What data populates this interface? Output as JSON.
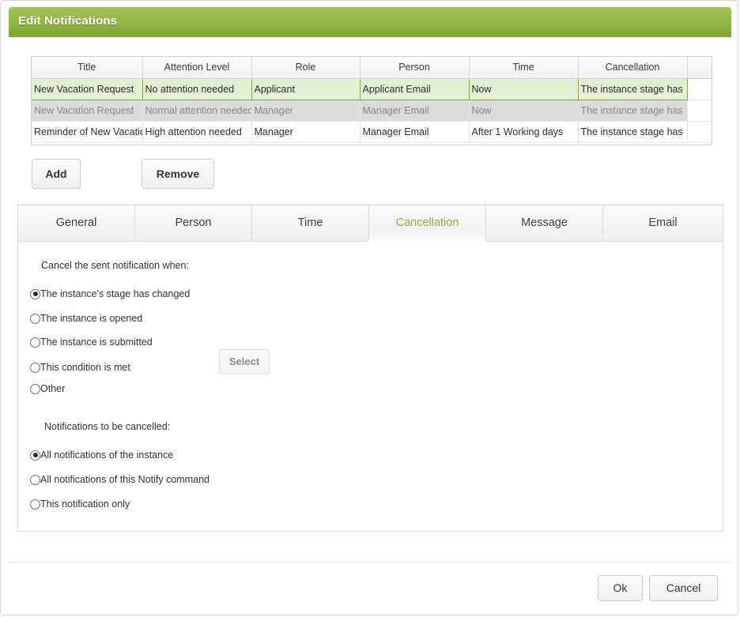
{
  "window": {
    "title": "Edit Notifications"
  },
  "grid": {
    "columns": [
      "Title",
      "Attention Level",
      "Role",
      "Person",
      "Time",
      "Cancellation",
      ""
    ],
    "rows": [
      {
        "state": "selected",
        "cells": [
          "New Vacation Request",
          "No attention needed",
          "Applicant",
          "Applicant Email",
          "Now",
          "The instance stage has",
          ""
        ]
      },
      {
        "state": "muted",
        "cells": [
          "New Vacation Request",
          "Normal attention needed",
          "Manager",
          "Manager Email",
          "Now",
          "The instance stage has",
          ""
        ]
      },
      {
        "state": "normal",
        "cells": [
          "Reminder of New Vacation",
          "High attention needed",
          "Manager",
          "Manager Email",
          "After 1 Working days",
          "The instance stage has",
          ""
        ]
      }
    ]
  },
  "toolbar": {
    "add_label": "Add",
    "remove_label": "Remove"
  },
  "tabs": [
    {
      "label": "General",
      "active": false
    },
    {
      "label": "Person",
      "active": false
    },
    {
      "label": "Time",
      "active": false
    },
    {
      "label": "Cancellation",
      "active": true
    },
    {
      "label": "Message",
      "active": false
    },
    {
      "label": "Email",
      "active": false
    }
  ],
  "panel": {
    "cancel_when_label": "Cancel the sent notification when:",
    "cancel_when_options": [
      {
        "label": "The instance's stage has changed",
        "checked": true
      },
      {
        "label": "The instance is opened",
        "checked": false
      },
      {
        "label": "The instance is submitted",
        "checked": false
      },
      {
        "label": "This condition is met",
        "checked": false
      },
      {
        "label": "Other",
        "checked": false
      }
    ],
    "select_button_label": "Select",
    "to_be_cancelled_label": "Notifications to be cancelled:",
    "to_be_cancelled_options": [
      {
        "label": "All notifications of the instance",
        "checked": true
      },
      {
        "label": "All notifications of this Notify command",
        "checked": false
      },
      {
        "label": "This notification only",
        "checked": false
      }
    ]
  },
  "footer": {
    "ok_label": "Ok",
    "cancel_label": "Cancel"
  },
  "colors": {
    "header_green_top": "#a3c254",
    "header_green_bottom": "#7ba52b",
    "active_tab_text": "#8cb03f",
    "selected_row_bg": "#e3f0d4",
    "selected_row_border": "#7faa3e",
    "muted_row_bg": "#dcdcdc"
  }
}
